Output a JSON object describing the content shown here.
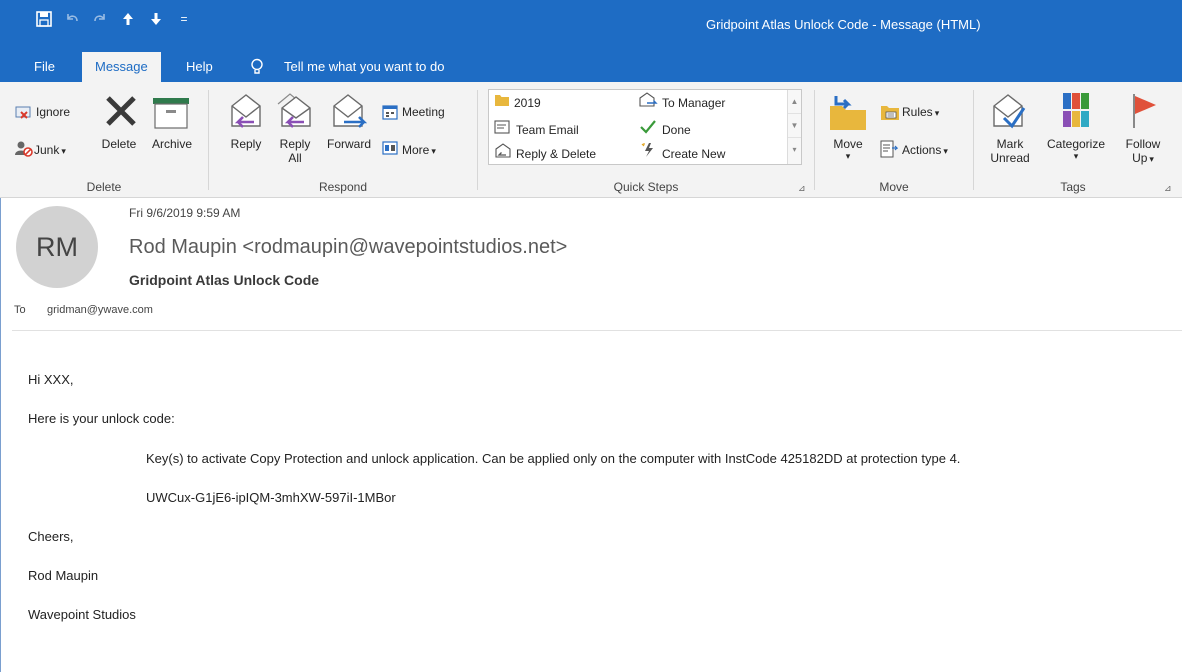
{
  "window": {
    "title": "Gridpoint Atlas Unlock Code  -  Message (HTML)"
  },
  "quick_access": {
    "save_icon": "save-icon",
    "undo_icon": "undo-icon",
    "redo_icon": "redo-icon",
    "up_icon": "arrow-up-icon",
    "down_icon": "arrow-down-icon",
    "customize_glyph": "="
  },
  "menu": {
    "file": "File",
    "message": "Message",
    "help": "Help",
    "tell_me": "Tell me what you want to do"
  },
  "ribbon": {
    "delete_group": {
      "label": "Delete",
      "ignore": "Ignore",
      "junk": "Junk",
      "delete": "Delete",
      "archive": "Archive"
    },
    "respond_group": {
      "label": "Respond",
      "reply": "Reply",
      "reply_all_1": "Reply",
      "reply_all_2": "All",
      "forward": "Forward",
      "meeting": "Meeting",
      "more": "More"
    },
    "quick_steps": {
      "label": "Quick Steps",
      "items": [
        "2019",
        "Team Email",
        "Reply & Delete",
        "To Manager",
        "Done",
        "Create New"
      ]
    },
    "move_group": {
      "label": "Move",
      "move": "Move",
      "rules": "Rules",
      "actions": "Actions"
    },
    "tags_group": {
      "label": "Tags",
      "mark_unread_1": "Mark",
      "mark_unread_2": "Unread",
      "categorize": "Categorize",
      "follow_up_1": "Follow",
      "follow_up_2": "Up"
    },
    "dropdown_glyph": "▾",
    "launcher_glyph": "⊿"
  },
  "message": {
    "avatar_initials": "RM",
    "date": "Fri 9/6/2019 9:59 AM",
    "from": "Rod Maupin <rodmaupin@wavepointstudios.net>",
    "subject": "Gridpoint Atlas Unlock Code",
    "to_label": "To",
    "to": "gridman@ywave.com"
  },
  "body": {
    "greeting": "Hi XXX,",
    "intro": "Here is your unlock code:",
    "key_text": "Key(s) to activate Copy Protection and unlock application. Can be applied only on the computer with InstCode 425182DD at protection type 4.",
    "unlock_code": "UWCux-G1jE6-ipIQM-3mhXW-597iI-1MBor",
    "signoff": "Cheers,",
    "sender_name": "Rod Maupin",
    "company": "Wavepoint Studios"
  },
  "colors": {
    "accent": "#1e6cc4",
    "ribbon_bg": "#f3f3f3",
    "purple_arrow": "#8a4fb5",
    "green_check": "#3a9a3a",
    "flag_red": "#e0513a"
  }
}
